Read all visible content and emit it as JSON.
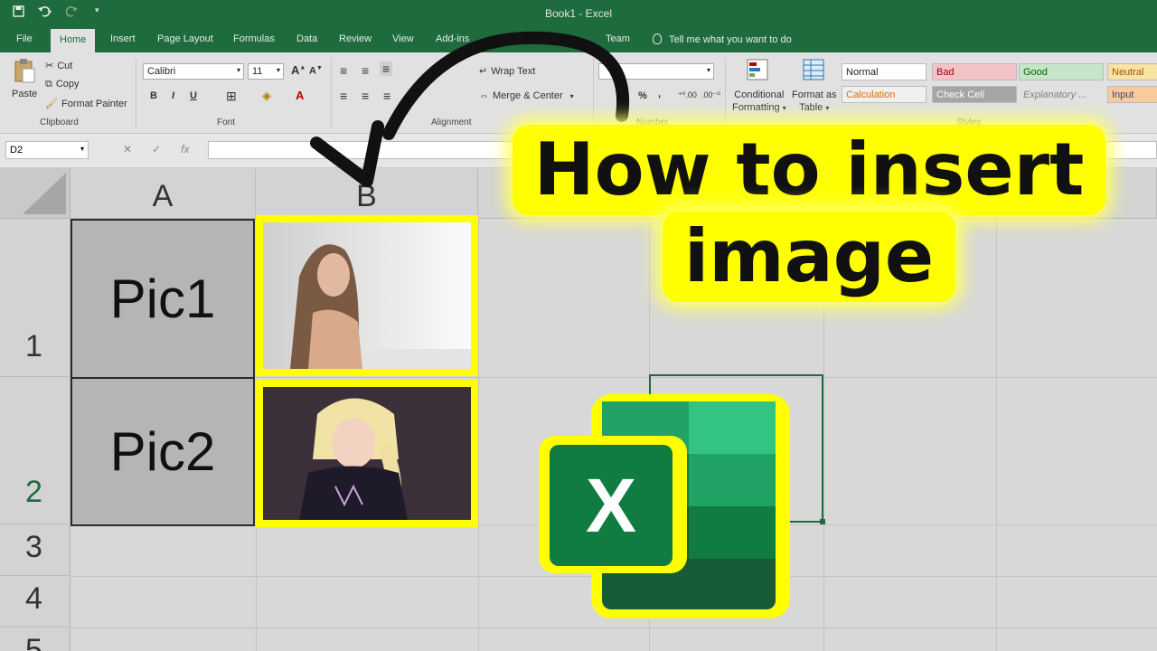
{
  "window": {
    "title": "Book1  -  Excel"
  },
  "qat": {
    "save_icon": "save-icon",
    "undo_icon": "undo-icon",
    "redo_icon": "redo-icon"
  },
  "tabs": [
    {
      "label": "File"
    },
    {
      "label": "Home"
    },
    {
      "label": "Insert"
    },
    {
      "label": "Page Layout"
    },
    {
      "label": "Formulas"
    },
    {
      "label": "Data"
    },
    {
      "label": "Review"
    },
    {
      "label": "View"
    },
    {
      "label": "Add-ins"
    },
    {
      "label": "Team"
    }
  ],
  "tell_me": "Tell me what you want to do",
  "clipboard": {
    "paste": "Paste",
    "cut": "Cut",
    "copy": "Copy",
    "format_painter": "Format Painter",
    "label": "Clipboard"
  },
  "font": {
    "name": "Calibri",
    "size": "11",
    "label": "Font",
    "bold": "B",
    "italic": "I",
    "underline": "U"
  },
  "alignment": {
    "wrap_text": "Wrap Text",
    "merge_center": "Merge & Center",
    "label": "Alignment"
  },
  "number": {
    "label": "Number",
    "percent": "%",
    "comma": ","
  },
  "styles": {
    "conditional": [
      "Conditional",
      "Formatting"
    ],
    "format_table": [
      "Format as",
      "Table"
    ],
    "label": "Styles",
    "cells": [
      {
        "name": "Normal",
        "bg": "#ffffff",
        "fg": "#222222"
      },
      {
        "name": "Bad",
        "bg": "#f2c4c8",
        "fg": "#9c0006"
      },
      {
        "name": "Good",
        "bg": "#c6e6c9",
        "fg": "#006100"
      },
      {
        "name": "Neutral",
        "bg": "#f7e3a3",
        "fg": "#9c5700"
      },
      {
        "name": "Calculation",
        "bg": "#f0f0f0",
        "fg": "#d46b08"
      },
      {
        "name": "Check Cell",
        "bg": "#a5a5a5",
        "fg": "#ffffff"
      },
      {
        "name": "Explanatory ...",
        "bg": "#e1e1e1",
        "fg": "#7f7f7f"
      },
      {
        "name": "Input",
        "bg": "#f8cb9e",
        "fg": "#3f3f76"
      }
    ]
  },
  "formula_bar": {
    "name_box": "D2",
    "cancel": "✕",
    "enter": "✓",
    "fx": "fx"
  },
  "grid": {
    "columns": [
      "A",
      "B"
    ],
    "rows": [
      "1",
      "2",
      "3",
      "4",
      "5"
    ],
    "cells": {
      "A1": "Pic1",
      "A2": "Pic2"
    }
  },
  "overlay": {
    "headline_line1": "How to insert",
    "headline_line2": "image"
  },
  "logo": {
    "letter": "X"
  },
  "colors": {
    "excel_green": "#1e6b3d",
    "highlight": "#ffff00"
  }
}
